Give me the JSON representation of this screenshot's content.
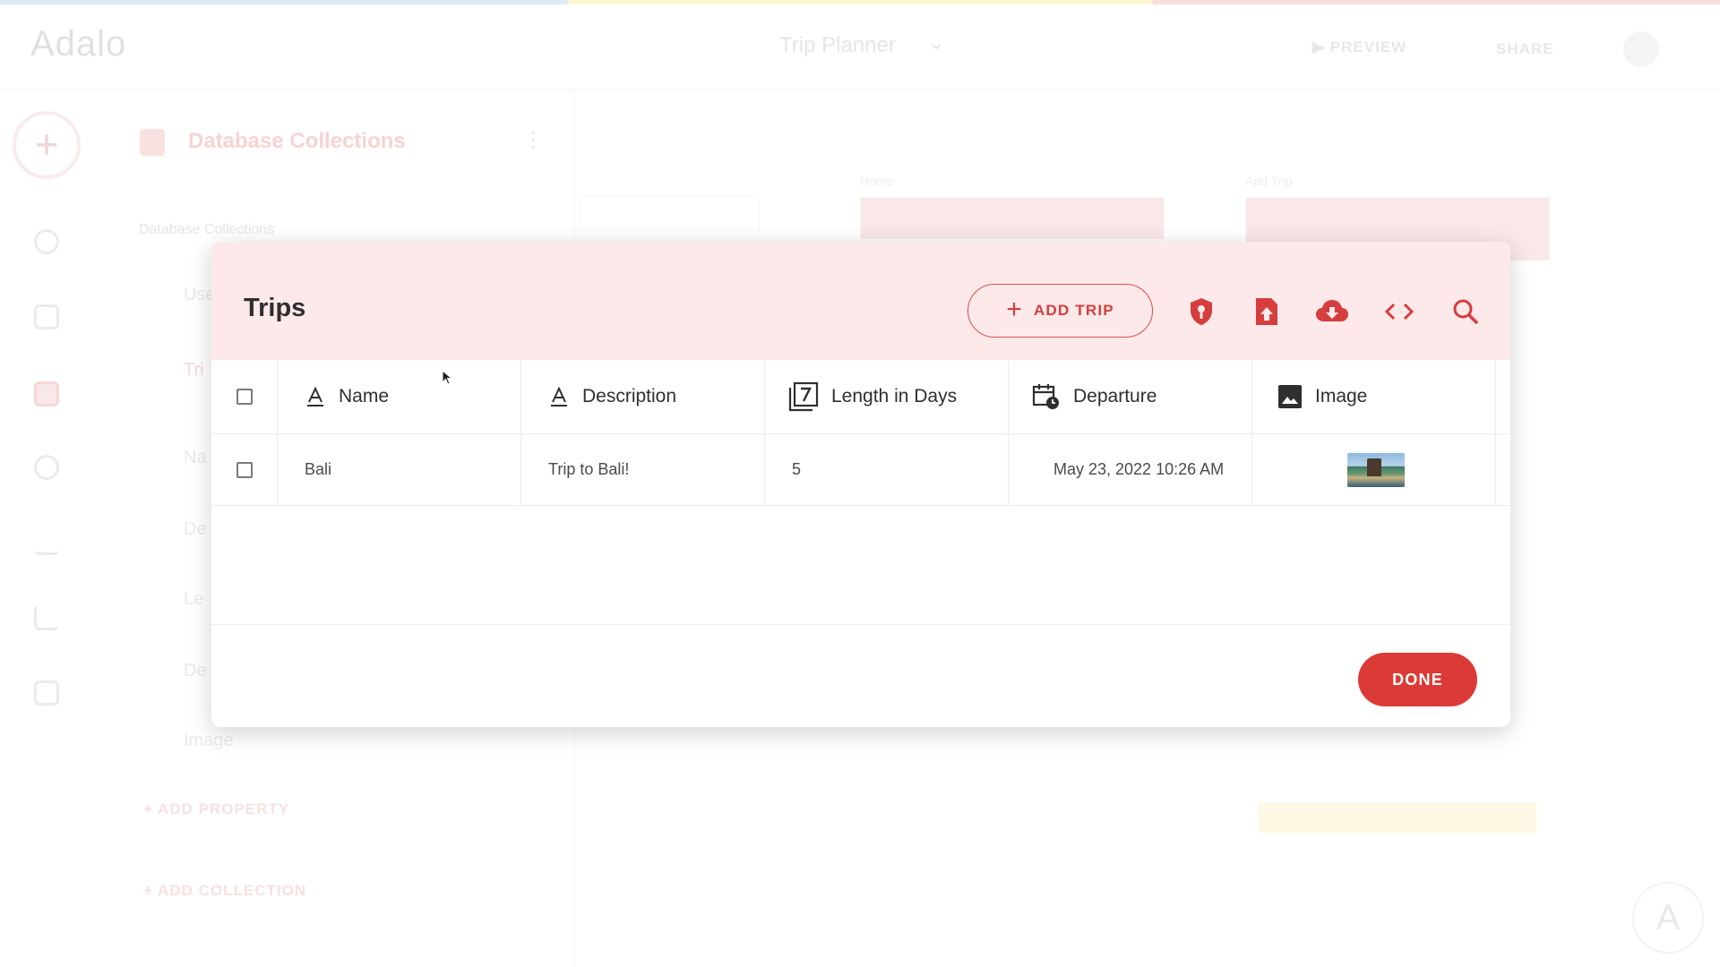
{
  "app": {
    "logo": "Adalo",
    "title": "Trip Planner",
    "preview_label": "PREVIEW",
    "share_label": "SHARE"
  },
  "panel": {
    "title": "Database Collections",
    "subtitle": "Database Collections",
    "collections": [
      "Use",
      "Tri"
    ],
    "properties": [
      "Na",
      "De",
      "Le",
      "De",
      "Image"
    ],
    "add_property_label": "ADD PROPERTY",
    "add_collection_label": "ADD COLLECTION"
  },
  "canvas": {
    "screens": [
      "Home",
      "Add Trip"
    ]
  },
  "modal": {
    "title": "Trips",
    "add_button_label": "ADD TRIP",
    "done_button_label": "DONE",
    "toolbar_icons": [
      "permissions-shield-icon",
      "upload-file-icon",
      "cloud-download-icon",
      "code-icon",
      "search-icon"
    ],
    "accent_color": "#dc3a36",
    "header_bg": "#fde9e9",
    "columns": [
      {
        "label": "Name",
        "icon": "text-icon"
      },
      {
        "label": "Description",
        "icon": "text-icon"
      },
      {
        "label": "Length in Days",
        "icon": "number-icon"
      },
      {
        "label": "Departure",
        "icon": "calendar-icon"
      },
      {
        "label": "Image",
        "icon": "image-icon"
      }
    ],
    "rows": [
      {
        "name": "Bali",
        "description": "Trip to Bali!",
        "length_in_days": "5",
        "departure": "May 23, 2022 10:26 AM",
        "image": "bali-thumbnail"
      }
    ]
  }
}
